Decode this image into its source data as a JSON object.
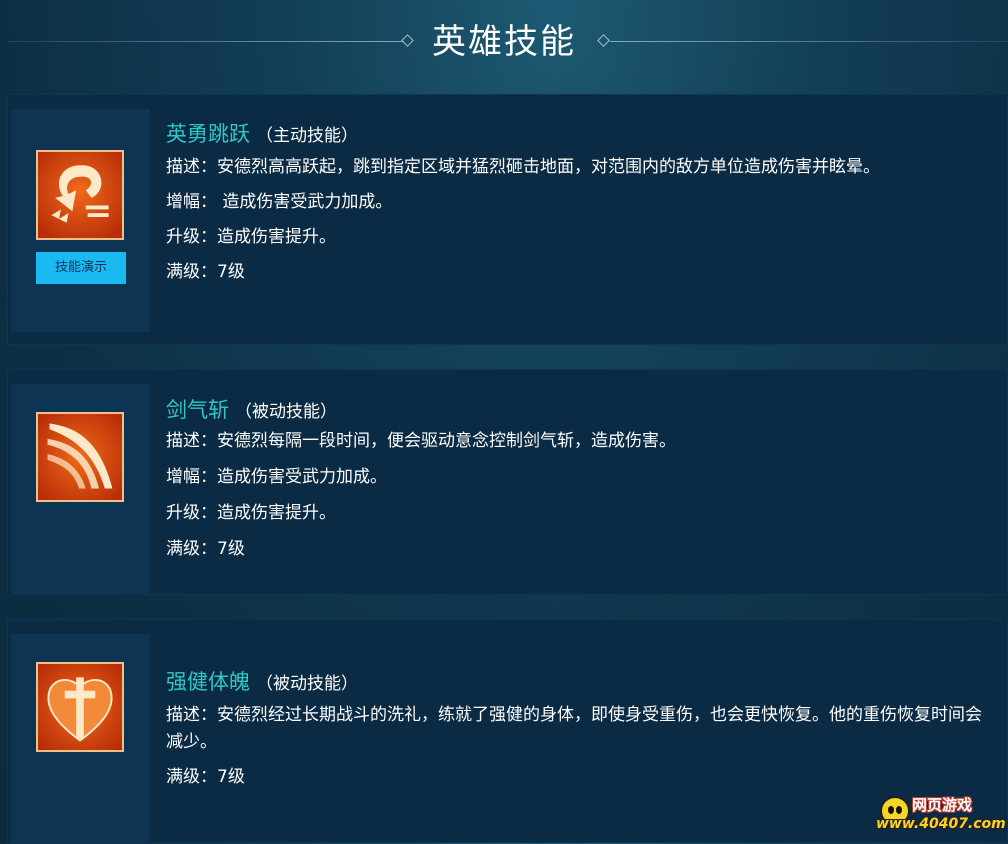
{
  "header": {
    "title": "英雄技能"
  },
  "skills": [
    {
      "name": "英勇跳跃",
      "type": "（主动技能）",
      "icon": "leap-arrow-icon",
      "demo_label": "技能演示",
      "lines": [
        "描述：安德烈高高跃起，跳到指定区域并猛烈砸击地面，对范围内的敌方单位造成伤害并眩晕。",
        "增幅： 造成伤害受武力加成。",
        "升级：造成伤害提升。",
        "满级：7级"
      ]
    },
    {
      "name": "剑气斩",
      "type": "（被动技能）",
      "icon": "sword-slash-icon",
      "lines": [
        "描述：安德烈每隔一段时间，便会驱动意念控制剑气斩，造成伤害。",
        "增幅：造成伤害受武力加成。",
        "升级：造成伤害提升。",
        "满级：7级"
      ]
    },
    {
      "name": "强健体魄",
      "type": "（被动技能）",
      "icon": "heart-cross-icon",
      "lines": [
        "描述：安德烈经过长期战斗的洗礼，练就了强健的身体，即使身受重伤，也会更快恢复。他的重伤恢复时间会减少。",
        "满级：7级"
      ]
    }
  ],
  "watermark": {
    "title": "网页游戏",
    "url": "www.40407.com"
  },
  "colors": {
    "accent": "#2ec7c7",
    "button": "#19b9f2",
    "card": "#0b2a44",
    "icon_panel": "#0d3452"
  }
}
